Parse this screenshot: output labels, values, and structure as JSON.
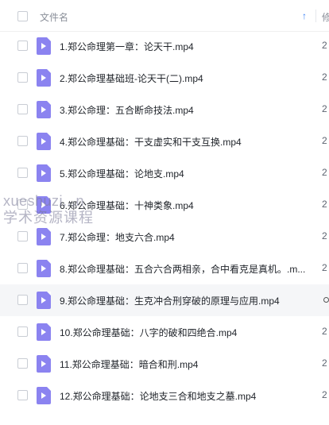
{
  "header": {
    "column_name": "文件名",
    "next_column_partial": "修"
  },
  "files": [
    {
      "name": "1.郑公命理第一章：论天干.mp4",
      "next": "2"
    },
    {
      "name": "2.郑公命理基础班-论天干(二).mp4",
      "next": "2"
    },
    {
      "name": "3.郑公命理：五合断命技法.mp4",
      "next": "2"
    },
    {
      "name": "4.郑公命理基础：干支虚实和干支互换.mp4",
      "next": "2"
    },
    {
      "name": "5.郑公命理基础：论地支.mp4",
      "next": "2"
    },
    {
      "name": "6.郑公命理基础：十神类象.mp4",
      "next": "2"
    },
    {
      "name": "7.郑公命理：地支六合.mp4",
      "next": "2"
    },
    {
      "name": "8.郑公命理基础：五合六合两相亲，合中看克是真机。.m...",
      "next": "2"
    },
    {
      "name": "9.郑公命理基础：生克冲合刑穿破的原理与应用.mp4",
      "next": ""
    },
    {
      "name": "10.郑公命理基础：八字的破和四绝合.mp4",
      "next": "2"
    },
    {
      "name": "11.郑公命理基础：暗合和刑.mp4",
      "next": "2"
    },
    {
      "name": "12.郑公命理基础：论地支三合和地支之墓.mp4",
      "next": "2"
    }
  ],
  "watermark": {
    "line1": "xueshuzi...n",
    "line2": "学术资源课程"
  },
  "colors": {
    "icon": "#8b83f0",
    "sort_accent": "#3b82f6",
    "highlight_row": "#f5f6f8"
  },
  "icons": {
    "sort": "arrow-up-icon",
    "file": "video-file-icon"
  }
}
